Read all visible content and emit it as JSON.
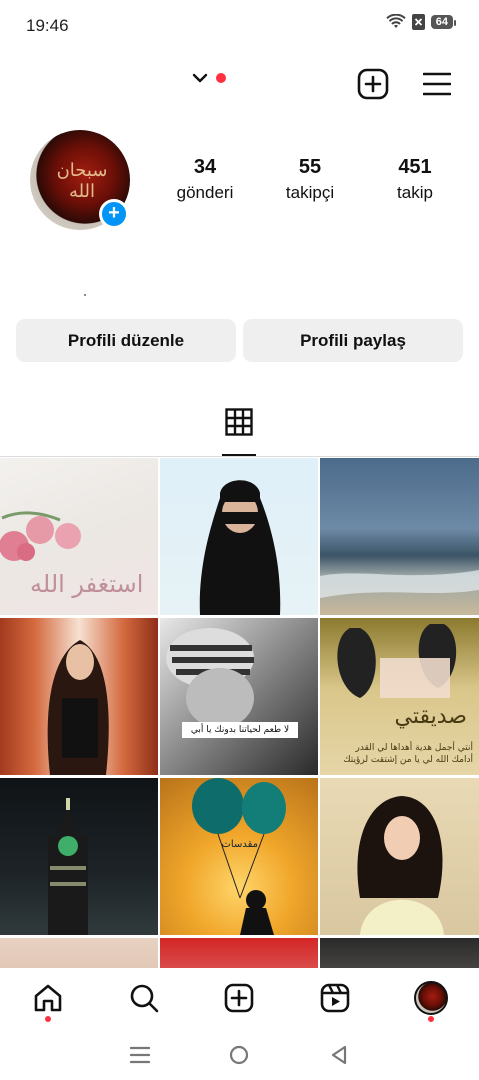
{
  "status_bar": {
    "time": "19:46",
    "battery": "64",
    "icons": [
      "wifi-icon",
      "no-sim-icon",
      "battery-icon"
    ]
  },
  "top_bar": {
    "icons": [
      "chevron-down-icon",
      "new-post-icon",
      "menu-icon"
    ],
    "notification_dot_color": "#ff3040"
  },
  "profile": {
    "avatar_text": "سبحان الله",
    "stats": [
      {
        "count": "34",
        "label": "gönderi"
      },
      {
        "count": "55",
        "label": "takipçi"
      },
      {
        "count": "451",
        "label": "takip"
      }
    ],
    "bio": "."
  },
  "buttons": {
    "edit_profile": "Profili düzenle",
    "share_profile": "Profili paylaş"
  },
  "tabs": {
    "active": "grid-icon"
  },
  "grid_captions": {
    "post1": "استغفر الله",
    "post5": "لا طعم لحياتنا بدونك يا أبي",
    "post6_title": "صديقتي",
    "post6_text": "أنتي أجمل هدية أهداها لي القدر أدامك الله لي يا من إشتقت لرؤيتك",
    "post8": "مقدسات"
  },
  "bottom_nav": {
    "items": [
      "home-icon",
      "search-icon",
      "create-icon",
      "reels-icon",
      "profile-avatar"
    ]
  },
  "system_nav": {
    "items": [
      "recents-icon",
      "home-circle-icon",
      "back-icon"
    ]
  },
  "colors": {
    "accent": "#0095f6",
    "notification": "#ff3040",
    "button_bg": "#efefef"
  }
}
